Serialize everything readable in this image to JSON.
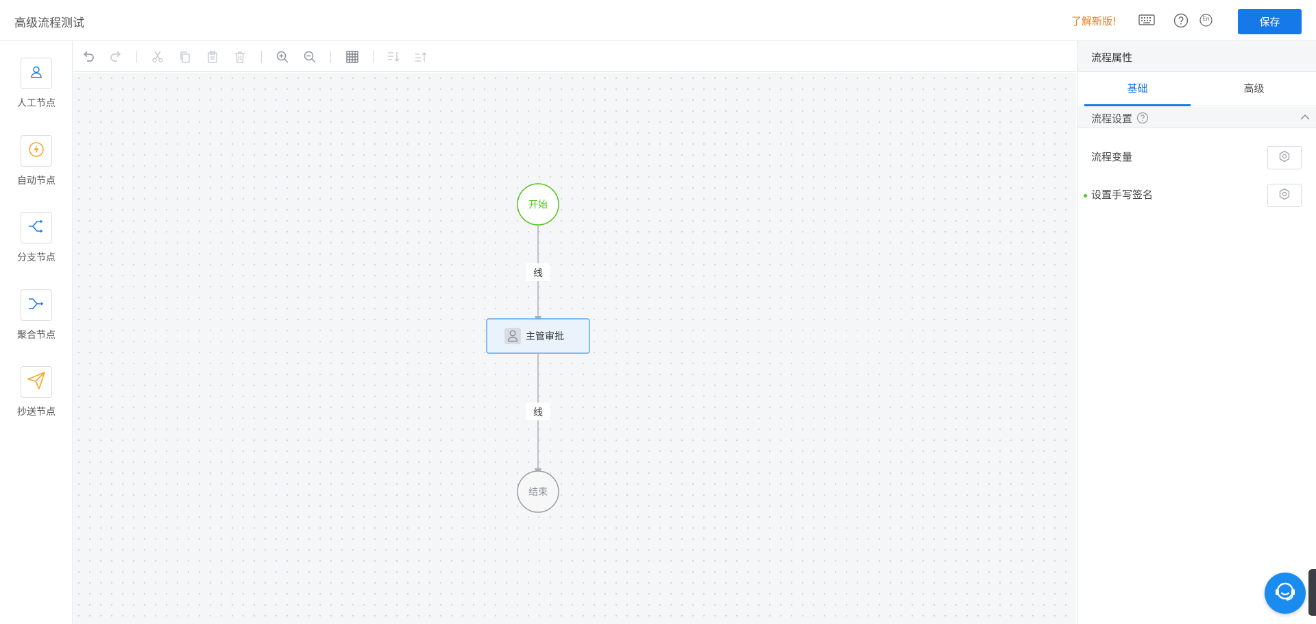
{
  "header": {
    "title": "高级流程测试",
    "new_version": "了解新版!",
    "lang_label": "En",
    "save_label": "保存"
  },
  "palette": {
    "items": [
      {
        "label": "人工节点",
        "icon": "user-icon",
        "color": "#1679ea"
      },
      {
        "label": "自动节点",
        "icon": "lightning-icon",
        "color": "#f5a623"
      },
      {
        "label": "分支节点",
        "icon": "branch-icon",
        "color": "#1679ea"
      },
      {
        "label": "聚合节点",
        "icon": "merge-icon",
        "color": "#1679ea"
      },
      {
        "label": "抄送节点",
        "icon": "send-icon",
        "color": "#f5a623"
      }
    ]
  },
  "toolbar": {
    "icons": [
      "undo-icon",
      "redo-icon",
      "cut-icon",
      "copy-icon",
      "paste-icon",
      "delete-icon",
      "zoom-in-icon",
      "zoom-out-icon",
      "grid-icon",
      "align-bottom-icon",
      "align-top-icon"
    ]
  },
  "flow": {
    "start_label": "开始",
    "edge1_label": "线",
    "task_label": "主管审批",
    "edge2_label": "线",
    "end_label": "结束"
  },
  "panel": {
    "title": "流程属性",
    "tabs": [
      {
        "label": "基础",
        "active": true
      },
      {
        "label": "高级",
        "active": false
      }
    ],
    "section_label": "流程设置",
    "rows": [
      {
        "label": "流程变量"
      },
      {
        "label": "设置手写签名"
      }
    ]
  },
  "colors": {
    "accent": "#1679ea",
    "orange": "#f5801f",
    "start_green": "#52c41a"
  }
}
